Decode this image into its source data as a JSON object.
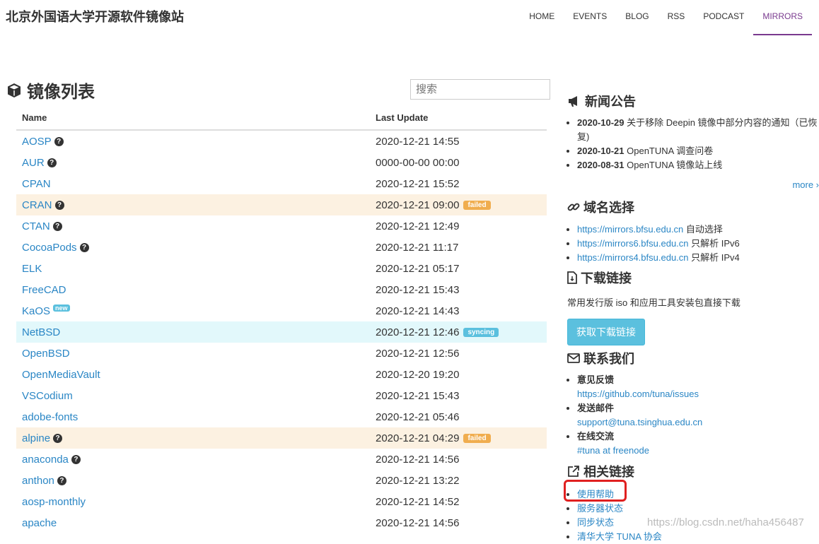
{
  "site": {
    "title": "北京外国语大学开源软件镜像站"
  },
  "nav": [
    "HOME",
    "EVENTS",
    "BLOG",
    "RSS",
    "PODCAST",
    "MIRRORS"
  ],
  "main": {
    "title": "镜像列表",
    "search_placeholder": "搜索",
    "col_name": "Name",
    "col_update": "Last Update"
  },
  "mirrors": [
    {
      "name": "AOSP",
      "help": true,
      "date": "2020-12-21 14:55",
      "status": ""
    },
    {
      "name": "AUR",
      "help": true,
      "date": "0000-00-00 00:00",
      "status": ""
    },
    {
      "name": "CPAN",
      "help": false,
      "date": "2020-12-21 15:52",
      "status": ""
    },
    {
      "name": "CRAN",
      "help": true,
      "date": "2020-12-21 09:00",
      "status": "failed"
    },
    {
      "name": "CTAN",
      "help": true,
      "date": "2020-12-21 12:49",
      "status": ""
    },
    {
      "name": "CocoaPods",
      "help": true,
      "date": "2020-12-21 11:17",
      "status": ""
    },
    {
      "name": "ELK",
      "help": false,
      "date": "2020-12-21 05:17",
      "status": ""
    },
    {
      "name": "FreeCAD",
      "help": false,
      "date": "2020-12-21 15:43",
      "status": ""
    },
    {
      "name": "KaOS",
      "help": false,
      "new": true,
      "date": "2020-12-21 14:43",
      "status": ""
    },
    {
      "name": "NetBSD",
      "help": false,
      "date": "2020-12-21 12:46",
      "status": "syncing"
    },
    {
      "name": "OpenBSD",
      "help": false,
      "date": "2020-12-21 12:56",
      "status": ""
    },
    {
      "name": "OpenMediaVault",
      "help": false,
      "date": "2020-12-20 19:20",
      "status": ""
    },
    {
      "name": "VSCodium",
      "help": false,
      "date": "2020-12-21 15:43",
      "status": ""
    },
    {
      "name": "adobe-fonts",
      "help": false,
      "date": "2020-12-21 05:46",
      "status": ""
    },
    {
      "name": "alpine",
      "help": true,
      "date": "2020-12-21 04:29",
      "status": "failed"
    },
    {
      "name": "anaconda",
      "help": true,
      "date": "2020-12-21 14:56",
      "status": ""
    },
    {
      "name": "anthon",
      "help": true,
      "date": "2020-12-21 13:22",
      "status": ""
    },
    {
      "name": "aosp-monthly",
      "help": false,
      "date": "2020-12-21 14:52",
      "status": ""
    },
    {
      "name": "apache",
      "help": false,
      "date": "2020-12-21 14:56",
      "status": ""
    }
  ],
  "badges": {
    "failed": "failed",
    "syncing": "syncing",
    "new": "new",
    "help": "?"
  },
  "news": {
    "title": "新闻公告",
    "items": [
      {
        "date": "2020-10-29",
        "text": "关于移除 Deepin 镜像中部分内容的通知（已恢复)"
      },
      {
        "date": "2020-10-21",
        "text": "OpenTUNA 调查问卷"
      },
      {
        "date": "2020-08-31",
        "text": "OpenTUNA 镜像站上线"
      }
    ],
    "more": "more ›"
  },
  "domains": {
    "title": "域名选择",
    "items": [
      {
        "url": "https://mirrors.bfsu.edu.cn",
        "note": "自动选择"
      },
      {
        "url": "https://mirrors6.bfsu.edu.cn",
        "note": "只解析 IPv6"
      },
      {
        "url": "https://mirrors4.bfsu.edu.cn",
        "note": "只解析 IPv4"
      }
    ]
  },
  "download": {
    "title": "下载链接",
    "desc": "常用发行版 iso 和应用工具安装包直接下载",
    "button": "获取下载链接"
  },
  "contact": {
    "title": "联系我们",
    "items": [
      {
        "label": "意见反馈",
        "link": "https://github.com/tuna/issues"
      },
      {
        "label": "发送邮件",
        "link": "support@tuna.tsinghua.edu.cn"
      },
      {
        "label": "在线交流",
        "link": "#tuna at freenode"
      }
    ]
  },
  "related": {
    "title": "相关链接",
    "items": [
      "使用帮助",
      "服务器状态",
      "同步状态",
      "清华大学 TUNA 协会"
    ]
  },
  "watermark": "https://blog.csdn.net/haha456487",
  "colors": {
    "accent": "#7a3a8f",
    "link": "#2a86c5",
    "failed": "#f0ad4e",
    "syncing": "#5bc0de",
    "highlight": "#e02020"
  }
}
